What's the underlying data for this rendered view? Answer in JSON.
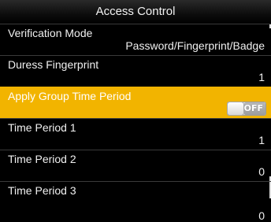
{
  "header": {
    "title": "Access Control"
  },
  "items": [
    {
      "label": "Verification Mode",
      "value": "Password/Fingerprint/Badge"
    },
    {
      "label": "Duress Fingerprint",
      "value": "1"
    },
    {
      "label": "Apply Group Time Period",
      "toggle_text": "OFF",
      "toggle_state": "off",
      "selected": true
    },
    {
      "label": "Time Period 1",
      "value": "1"
    },
    {
      "label": "Time Period 2",
      "value": "0"
    },
    {
      "label": "Time Period 3",
      "value": "0"
    }
  ],
  "colors": {
    "highlight": "#f2b400",
    "background": "#000000",
    "text": "#ffffff"
  }
}
